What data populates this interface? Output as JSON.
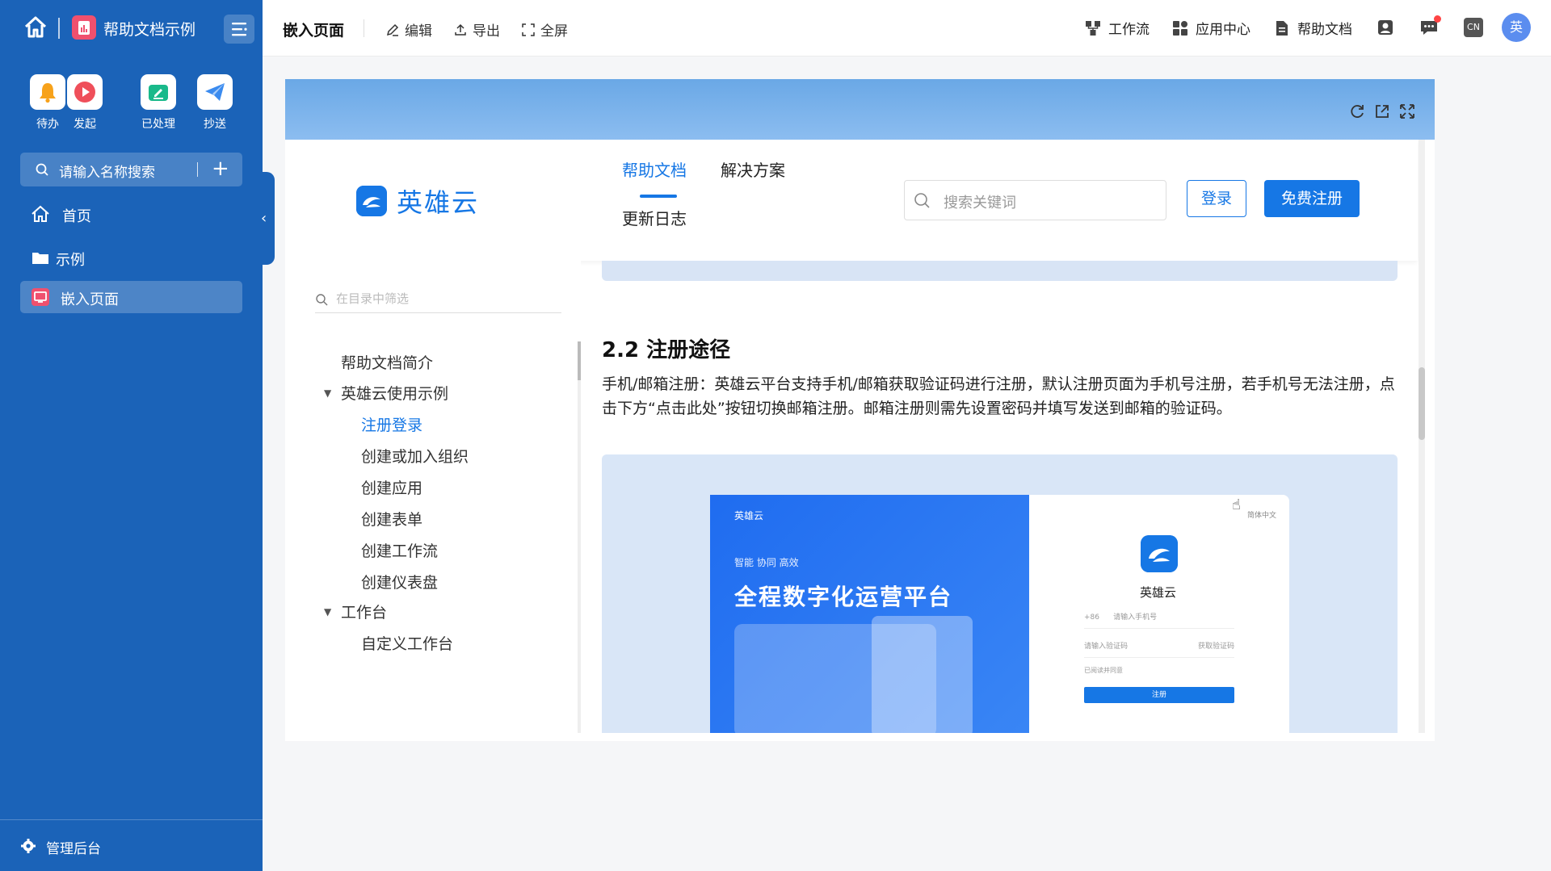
{
  "sidebar": {
    "app_title": "帮助文档示例",
    "quick_actions": [
      {
        "label": "待办",
        "icon": "bell-icon"
      },
      {
        "label": "发起",
        "icon": "play-icon"
      },
      {
        "label": "已处理",
        "icon": "check-edit-icon"
      },
      {
        "label": "抄送",
        "icon": "paper-plane-icon"
      }
    ],
    "search_placeholder": "请输入名称搜索",
    "nav": [
      {
        "label": "首页",
        "icon": "home-icon"
      },
      {
        "label": "示例",
        "icon": "folder-icon"
      },
      {
        "label": "嵌入页面",
        "icon": "embed-page-icon",
        "active": true
      }
    ],
    "footer_label": "管理后台"
  },
  "topbar": {
    "page_title": "嵌入页面",
    "actions": [
      "编辑",
      "导出",
      "全屏"
    ],
    "right_links": [
      "工作流",
      "应用中心",
      "帮助文档"
    ],
    "lang_label": "CN",
    "avatar_text": "英"
  },
  "embed": {
    "site": {
      "logo_text": "英雄云",
      "nav": [
        "帮助文档",
        "解决方案",
        "更新日志"
      ],
      "active_nav": "帮助文档",
      "search_placeholder": "搜索关键词",
      "login_label": "登录",
      "register_label": "免费注册"
    },
    "toc": {
      "filter_placeholder": "在目录中筛选",
      "items": [
        {
          "label": "帮助文档简介",
          "level": 1
        },
        {
          "label": "英雄云使用示例",
          "level": 1,
          "expanded": true
        },
        {
          "label": "注册登录",
          "level": 2,
          "active": true
        },
        {
          "label": "创建或加入组织",
          "level": 2
        },
        {
          "label": "创建应用",
          "level": 2
        },
        {
          "label": "创建表单",
          "level": 2
        },
        {
          "label": "创建工作流",
          "level": 2
        },
        {
          "label": "创建仪表盘",
          "level": 2
        },
        {
          "label": "工作台",
          "level": 1,
          "expanded": true
        },
        {
          "label": "自定义工作台",
          "level": 2
        }
      ]
    },
    "article": {
      "section_title": "2.2 注册途径",
      "paragraph": "手机/邮箱注册：英雄云平台支持手机/邮箱获取验证码进行注册，默认注册页面为手机号注册，若手机号无法注册，点击下方“点击此处”按钮切换邮箱注册。邮箱注册则需先设置密码并填写发送到邮箱的验证码。",
      "screenshot": {
        "brand": "英雄云",
        "tagline": "智能 协同 高效",
        "headline": "全程数字化运营平台",
        "lang": "简体中文",
        "app_name": "英雄云",
        "phone_prefix": "+86",
        "phone_placeholder": "请输入手机号",
        "code_placeholder": "请输入验证码",
        "code_button": "获取验证码",
        "agree_text": "已阅读并同意",
        "submit_label": "注册"
      }
    }
  },
  "colors": {
    "sidebar": "#1b63b8",
    "accent": "#1677e5"
  }
}
